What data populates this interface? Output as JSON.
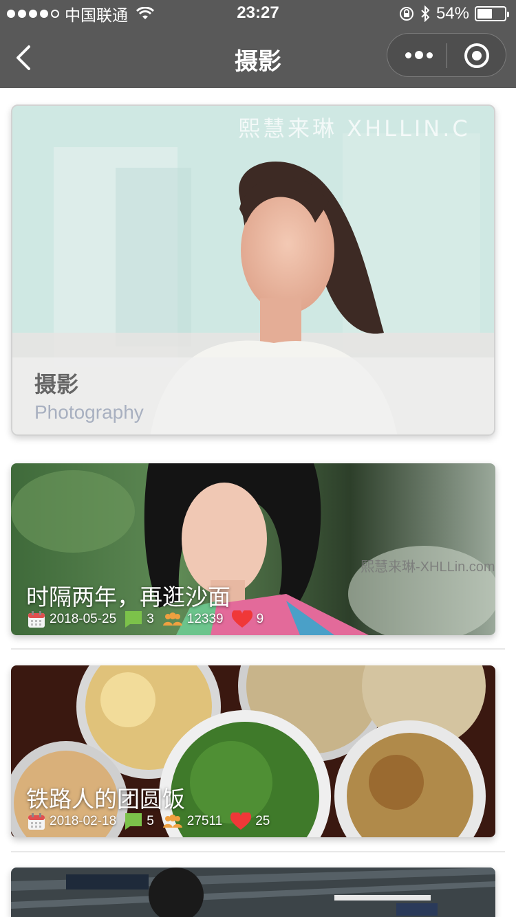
{
  "status_bar": {
    "carrier": "中国联通",
    "time": "23:27",
    "battery": "54%",
    "battery_level": 0.54
  },
  "nav": {
    "title": "摄影"
  },
  "hero": {
    "watermark": "熙慧来琳 XHLLIN.C",
    "title": "摄影",
    "subtitle": "Photography"
  },
  "articles": [
    {
      "title": "时隔两年，再逛沙面",
      "date": "2018-05-25",
      "comments": "3",
      "views": "12339",
      "likes": "9",
      "watermark": "熙慧来琳-XHLLin.com"
    },
    {
      "title": "铁路人的团圆饭",
      "date": "2018-02-18",
      "comments": "5",
      "views": "27511",
      "likes": "25"
    }
  ],
  "colors": {
    "bar": "#595959",
    "comment_icon": "#7cc24a",
    "views_icon": "#f0a040",
    "likes_icon": "#f03838",
    "calendar_icon": "#e05050"
  }
}
